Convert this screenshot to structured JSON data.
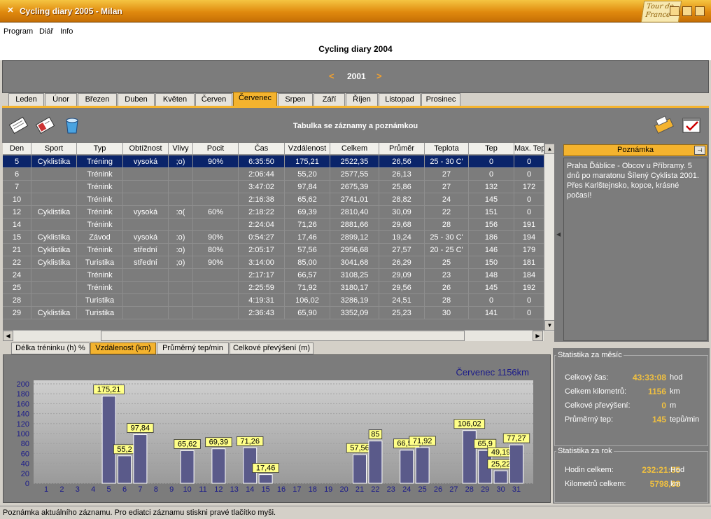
{
  "window": {
    "title": "Cycling diary 2005 - Milan",
    "logo": "Tour de France"
  },
  "menu": [
    "Program",
    "Diář",
    "Info"
  ],
  "app_title": "Cycling diary 2004",
  "year": "2001",
  "months": [
    "Leden",
    "Únor",
    "Březen",
    "Duben",
    "Květen",
    "Červen",
    "Červenec",
    "Srpen",
    "Září",
    "Říjen",
    "Listopad",
    "Prosinec"
  ],
  "active_month": "Červenec",
  "toolbar_title": "Tabulka se záznamy a poznámkou",
  "columns": [
    "Den",
    "Sport",
    "Typ",
    "Obtížnost",
    "Vlivy",
    "Pocit",
    "Čas",
    "Vzdálenost",
    "Celkem",
    "Průměr",
    "Teplota",
    "Tep",
    "Max. Tep"
  ],
  "rows": [
    [
      "5",
      "Cyklistika",
      "Tréning",
      "vysoká",
      ";o)",
      "90%",
      "6:35:50",
      "175,21",
      "2522,35",
      "26,56",
      "25 - 30 C'",
      "0",
      "0"
    ],
    [
      "6",
      "",
      "Trénink",
      "",
      "",
      "",
      "2:06:44",
      "55,20",
      "2577,55",
      "26,13",
      "27",
      "0",
      "0"
    ],
    [
      "7",
      "",
      "Trénink",
      "",
      "",
      "",
      "3:47:02",
      "97,84",
      "2675,39",
      "25,86",
      "27",
      "132",
      "172"
    ],
    [
      "10",
      "",
      "Trénink",
      "",
      "",
      "",
      "2:16:38",
      "65,62",
      "2741,01",
      "28,82",
      "24",
      "145",
      "0"
    ],
    [
      "12",
      "Cyklistika",
      "Trénink",
      "vysoká",
      ":o(",
      "60%",
      "2:18:22",
      "69,39",
      "2810,40",
      "30,09",
      "22",
      "151",
      "0"
    ],
    [
      "14",
      "",
      "Trénink",
      "",
      "",
      "",
      "2:24:04",
      "71,26",
      "2881,66",
      "29,68",
      "28",
      "156",
      "191"
    ],
    [
      "15",
      "Cyklistika",
      "Závod",
      "vysoká",
      ":o)",
      "90%",
      "0:54:27",
      "17,46",
      "2899,12",
      "19,24",
      "25 - 30 C'",
      "186",
      "194"
    ],
    [
      "21",
      "Cyklistika",
      "Trénink",
      "střední",
      ":o)",
      "80%",
      "2:05:17",
      "57,56",
      "2956,68",
      "27,57",
      "20 - 25 C'",
      "146",
      "179"
    ],
    [
      "22",
      "Cyklistika",
      "Turistika",
      "střední",
      ";o)",
      "90%",
      "3:14:00",
      "85,00",
      "3041,68",
      "26,29",
      "25",
      "150",
      "181"
    ],
    [
      "24",
      "",
      "Trénink",
      "",
      "",
      "",
      "2:17:17",
      "66,57",
      "3108,25",
      "29,09",
      "23",
      "148",
      "184"
    ],
    [
      "25",
      "",
      "Trénink",
      "",
      "",
      "",
      "2:25:59",
      "71,92",
      "3180,17",
      "29,56",
      "26",
      "145",
      "192"
    ],
    [
      "28",
      "",
      "Turistika",
      "",
      "",
      "",
      "4:19:31",
      "106,02",
      "3286,19",
      "24,51",
      "28",
      "0",
      "0"
    ],
    [
      "29",
      "Cyklistika",
      "Turistika",
      "",
      "",
      "",
      "2:36:43",
      "65,90",
      "3352,09",
      "25,23",
      "30",
      "141",
      "0"
    ]
  ],
  "note": {
    "header": "Poznámka",
    "text": "Praha Ďáblice - Obcov u Příbramy. 5 dnů po maratonu Šílený Cyklista 2001. Přes Karlštejnsko, kopce, krásné počasí!"
  },
  "chart_tabs": [
    "Délka tréninku (h) %",
    "Vzdálenost (km)",
    "Průměrný tep/min",
    "Celkové převýšení (m)"
  ],
  "active_chart_tab": "Vzdálenost (km)",
  "chart_data": {
    "type": "bar",
    "title": "Červenec 1156km",
    "x": [
      1,
      2,
      3,
      4,
      5,
      6,
      7,
      8,
      9,
      10,
      11,
      12,
      13,
      14,
      15,
      16,
      17,
      18,
      19,
      20,
      21,
      22,
      23,
      24,
      25,
      26,
      27,
      28,
      29,
      30,
      31
    ],
    "bars": [
      {
        "day": 5,
        "value": 175.21,
        "label": "175,21"
      },
      {
        "day": 6,
        "value": 55.2,
        "label": "55,2"
      },
      {
        "day": 7,
        "value": 97.84,
        "label": "97,84"
      },
      {
        "day": 10,
        "value": 65.62,
        "label": "65,62"
      },
      {
        "day": 12,
        "value": 69.39,
        "label": "69,39"
      },
      {
        "day": 14,
        "value": 71.26,
        "label": "71,26"
      },
      {
        "day": 15,
        "value": 17.46,
        "label": "17,46"
      },
      {
        "day": 21,
        "value": 57.56,
        "label": "57,56"
      },
      {
        "day": 22,
        "value": 85,
        "label": "85"
      },
      {
        "day": 24,
        "value": 66.57,
        "label": "66,57"
      },
      {
        "day": 25,
        "value": 71.92,
        "label": "71,92"
      },
      {
        "day": 28,
        "value": 106.02,
        "label": "106,02"
      },
      {
        "day": 29,
        "value": 65.9,
        "label": "65,9"
      },
      {
        "day": 30,
        "value": 25.22,
        "label": "25,22"
      },
      {
        "day": 30,
        "value": 49.19,
        "label": "49,19"
      },
      {
        "day": 31,
        "value": 77.27,
        "label": "77,27"
      }
    ],
    "yticks": [
      0,
      20,
      40,
      60,
      80,
      100,
      120,
      140,
      160,
      180,
      200
    ],
    "ylim": [
      0,
      200
    ],
    "grid": true
  },
  "stats_month": {
    "title": "Statistika za měsíc",
    "items": [
      {
        "label": "Celkový čas:",
        "value": "43:33:08",
        "unit": "hod"
      },
      {
        "label": "Celkem kilometrů:",
        "value": "1156",
        "unit": "km"
      },
      {
        "label": "Celkové převýšení:",
        "value": "0",
        "unit": "m"
      },
      {
        "label": "Průměrný tep:",
        "value": "145",
        "unit": "tepů/min"
      }
    ]
  },
  "stats_year": {
    "title": "Statistika za rok",
    "items": [
      {
        "label": "Hodin celkem:",
        "value": "232:21:35",
        "unit": "Hod"
      },
      {
        "label": "Kilometrů celkem:",
        "value": "5798,88",
        "unit": "km"
      }
    ]
  },
  "status": "Poznámka aktuálního záznamu. Pro ediatci záznamu stiskni pravé tlačítko myši.",
  "colors": {
    "accent": "#f4b32e",
    "panel": "#7c7c7c",
    "selected": "#0a246a",
    "bar": "#5a5a8a",
    "labelbg": "#ffff88"
  }
}
